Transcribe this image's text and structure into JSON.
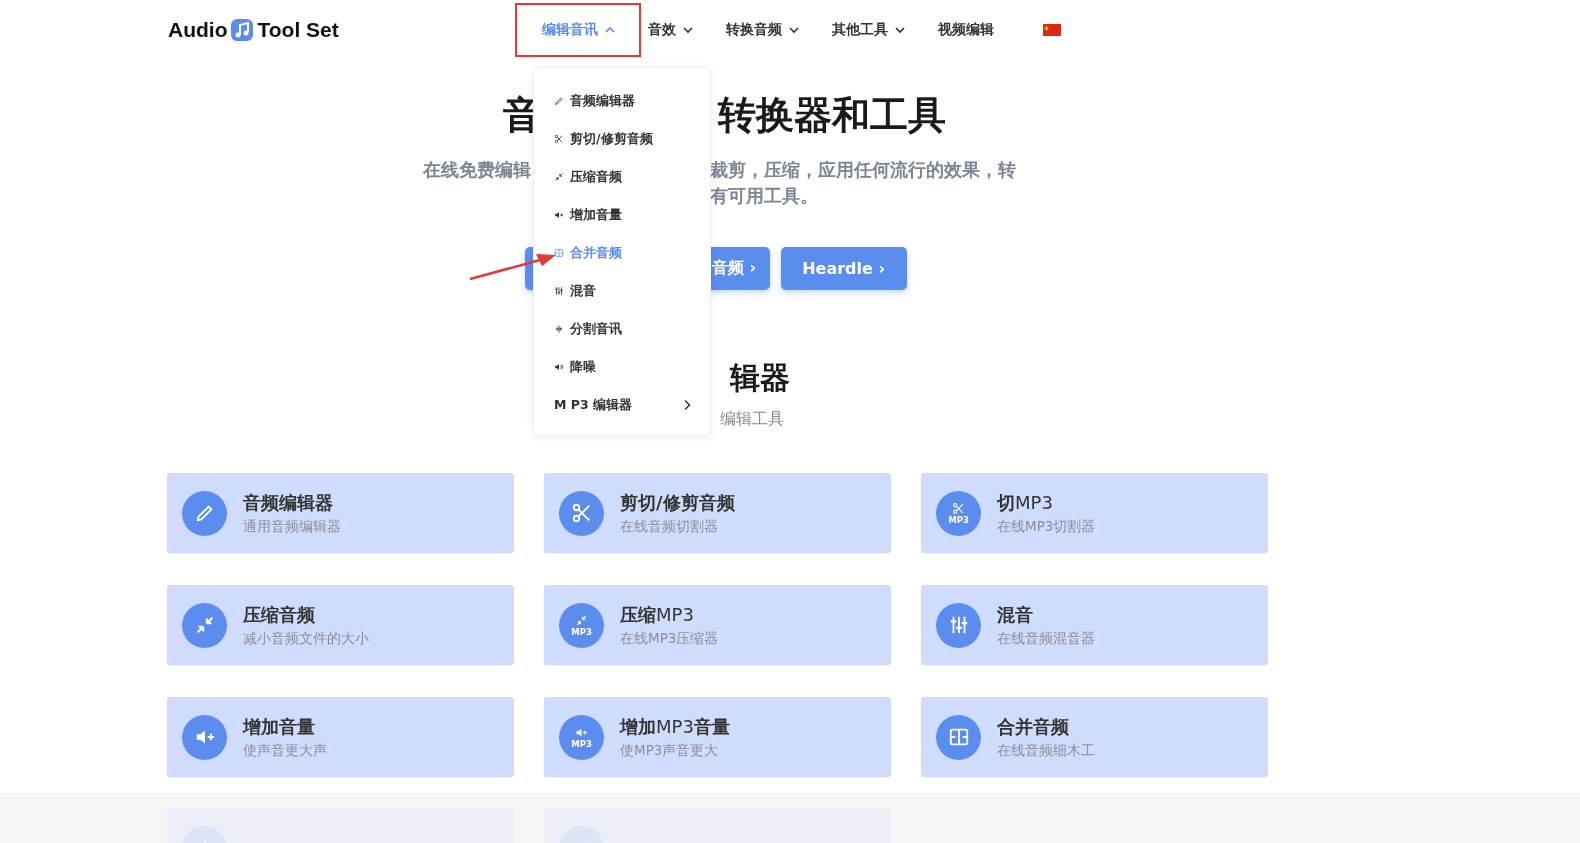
{
  "header": {
    "logo": {
      "left": "Audio",
      "right": "Tool Set"
    },
    "nav": [
      {
        "label": "编辑音讯",
        "expanded": true,
        "kind": "menu"
      },
      {
        "label": "音效",
        "expanded": false,
        "kind": "menu"
      },
      {
        "label": "转换音频",
        "expanded": false,
        "kind": "menu"
      },
      {
        "label": "其他工具",
        "expanded": false,
        "kind": "menu"
      },
      {
        "label": "视频编辑",
        "kind": "link"
      }
    ]
  },
  "dropdown": {
    "items": [
      {
        "label": "音频编辑器",
        "kind": "pencil",
        "selected": false
      },
      {
        "label": "剪切/修剪音频",
        "kind": "scissors",
        "selected": false
      },
      {
        "label": "压缩音频",
        "kind": "compress",
        "selected": false
      },
      {
        "label": "增加音量",
        "kind": "volume-plus",
        "selected": false
      },
      {
        "label": "合并音频",
        "kind": "merge",
        "selected": true
      },
      {
        "label": "混音",
        "kind": "mixer",
        "selected": false
      },
      {
        "label": "分割音讯",
        "kind": "split",
        "selected": false
      },
      {
        "label": "降噪",
        "kind": "denoise",
        "selected": false
      },
      {
        "label": "M P3 编辑器",
        "kind": "submenu",
        "selected": false
      }
    ]
  },
  "hero": {
    "title_left": "音",
    "title_right": "转换器和工具",
    "subtitle_line_1_left": "在线免费编辑",
    "subtitle_line_1_right": "裁剪，压缩，应用任何流行的效果，转",
    "subtitle_line_2_right": "有可用工具。",
    "buttons": [
      {
        "kind": "covered"
      },
      {
        "kind": "label",
        "label": "音频",
        "chevron": "›"
      },
      {
        "kind": "label",
        "label": "Heardle",
        "chevron": "›"
      }
    ]
  },
  "section": {
    "title": "辑器",
    "subtitle": "编辑工具"
  },
  "cards": [
    {
      "title": "音频编辑器",
      "description": "通用音频编辑器",
      "kind": "pencil"
    },
    {
      "title": "剪切/修剪音频",
      "description": "在线音频切割器",
      "kind": "scissors"
    },
    {
      "title": "**切**MP3",
      "description": "在线MP3切割器",
      "kind": "scissors",
      "icon_text": "MP3"
    },
    {
      "title": "压缩音频",
      "description": "减小音频文件的大小",
      "kind": "compress"
    },
    {
      "title": "**压缩**MP3",
      "description": "在线MP3压缩器",
      "kind": "compress",
      "icon_text": "MP3"
    },
    {
      "title": "混音",
      "description": "在线音频混音器",
      "kind": "mixer"
    },
    {
      "title": "增加音量",
      "description": "使声音更大声",
      "kind": "volume-plus"
    },
    {
      "title": "**增加**MP3**音量**",
      "description": "使MP3声音更大",
      "kind": "volume-plus",
      "icon_text": "MP3"
    },
    {
      "title": "合并音频",
      "description": "在线音频细木工",
      "kind": "merge"
    }
  ],
  "faded_cards": [
    {
      "kind": "split"
    },
    {
      "kind": "denoise"
    }
  ]
}
